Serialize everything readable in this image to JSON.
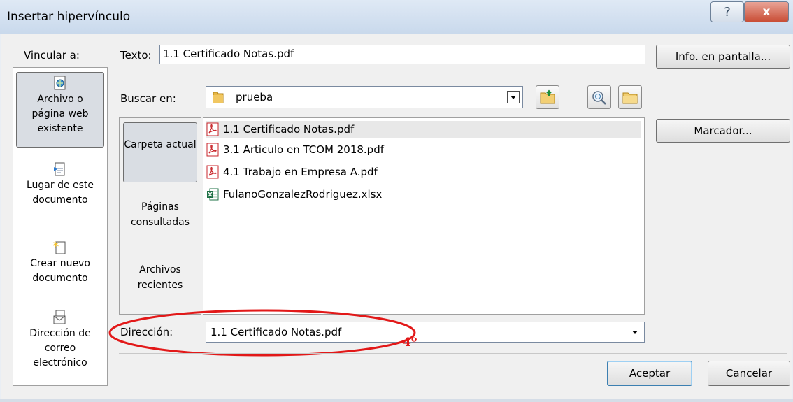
{
  "window": {
    "title": "Insertar hipervínculo",
    "help_label": "?",
    "close_label": "x"
  },
  "link_to": {
    "label": "Vincular a:",
    "items": [
      {
        "label": "Archivo o página web existente",
        "icon": "web-file-icon",
        "selected": true
      },
      {
        "label": "Lugar de este documento",
        "icon": "document-place-icon",
        "selected": false
      },
      {
        "label": "Crear nuevo documento",
        "icon": "new-document-icon",
        "selected": false
      },
      {
        "label": "Dirección de correo electrónico",
        "icon": "email-icon",
        "selected": false
      }
    ]
  },
  "text_to_display": {
    "label": "Texto:",
    "value": "1.1 Certificado Notas.pdf"
  },
  "screen_tip_label": "Info. en pantalla...",
  "look_in": {
    "label": "Buscar en:",
    "value": "prueba",
    "folder_icon": "folder-icon"
  },
  "browse_options": {
    "items": [
      {
        "label": "Carpeta actual",
        "selected": true
      },
      {
        "label": "Páginas consultadas",
        "selected": false
      },
      {
        "label": "Archivos recientes",
        "selected": false
      }
    ]
  },
  "files": [
    {
      "name": "1.1 Certificado Notas.pdf",
      "icon": "pdf-file-icon",
      "selected": true
    },
    {
      "name": "3.1 Articulo en TCOM 2018.pdf",
      "icon": "pdf-file-icon",
      "selected": false
    },
    {
      "name": "4.1 Trabajo en Empresa A.pdf",
      "icon": "pdf-file-icon",
      "selected": false
    },
    {
      "name": "FulanoGonzalezRodriguez.xlsx",
      "icon": "excel-file-icon",
      "selected": false
    }
  ],
  "bookmark_label": "Marcador...",
  "address": {
    "label": "Dirección:",
    "value": "1.1 Certificado Notas.pdf"
  },
  "annotation": {
    "text": "4º",
    "color": "#e21818"
  },
  "buttons": {
    "ok": "Aceptar",
    "cancel": "Cancelar"
  },
  "colors": {
    "accent": "#3c7fb1",
    "pdf": "#c8262b",
    "excel": "#1d7044"
  }
}
